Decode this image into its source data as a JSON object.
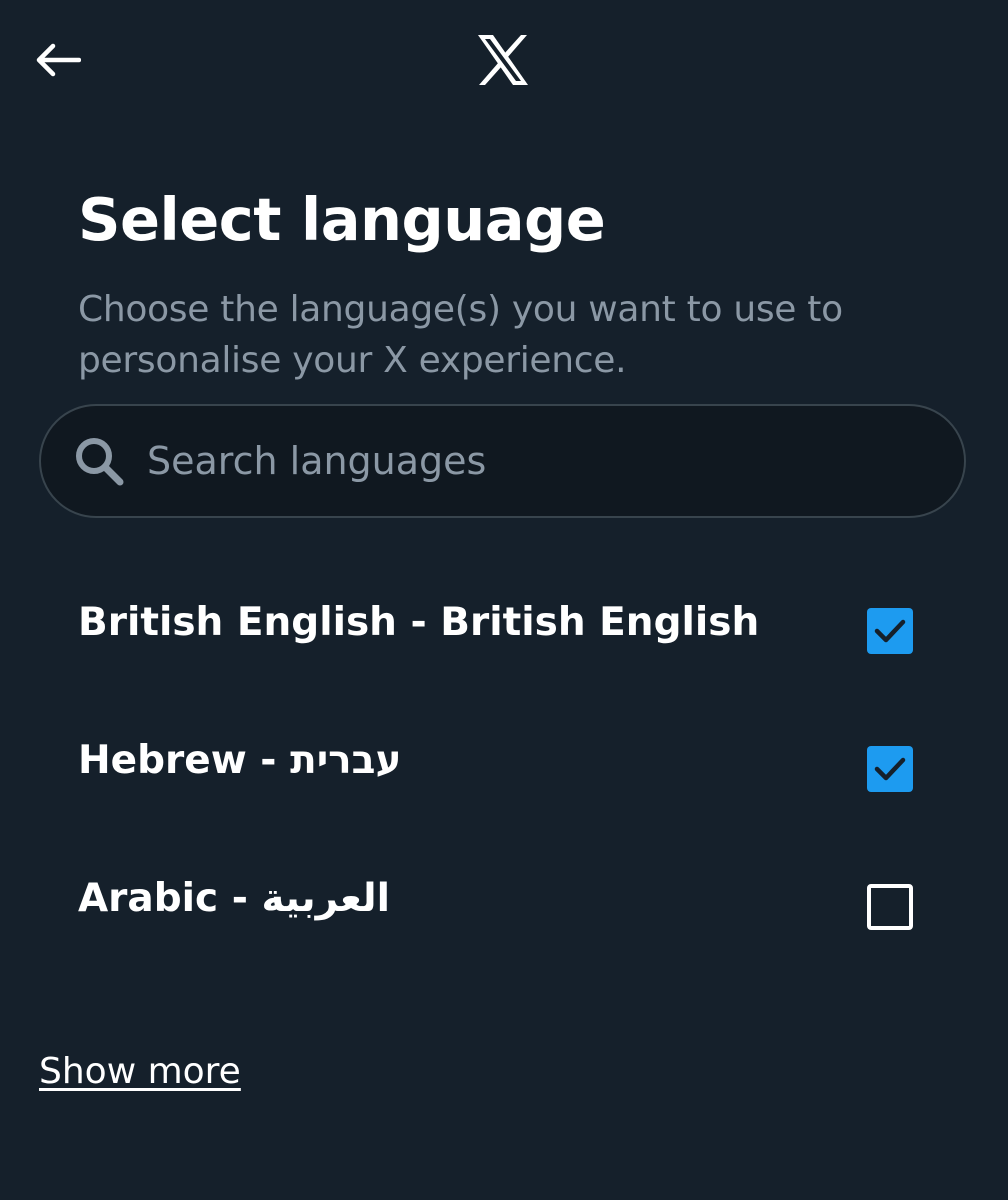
{
  "header": {
    "back_icon": "arrow-left-icon",
    "logo_icon": "x-logo-icon"
  },
  "page": {
    "title": "Select language",
    "subtitle": "Choose the language(s) you want to use to personalise your X experience."
  },
  "search": {
    "icon": "search-icon",
    "placeholder": "Search languages",
    "value": ""
  },
  "languages": [
    {
      "label": "British English - British English",
      "checked": true
    },
    {
      "label": "Hebrew - עברית",
      "checked": true
    },
    {
      "label": "Arabic - العربية",
      "checked": false
    }
  ],
  "show_more_label": "Show more",
  "colors": {
    "background": "#15202b",
    "accent": "#1d9bf0",
    "secondary_text": "#8b98a5",
    "border": "#38444d"
  }
}
